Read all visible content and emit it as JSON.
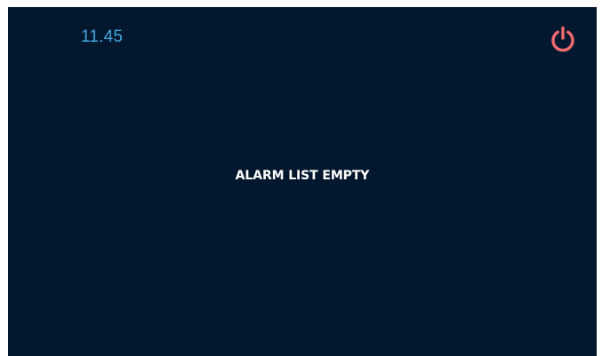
{
  "status_bar": {
    "time": "11.45",
    "power_icon": "power-icon"
  },
  "alarm_list": {
    "empty_message": "ALARM LIST EMPTY"
  },
  "colors": {
    "background": "#03182e",
    "time": "#3fa9e0",
    "power_icon": "#f06b6e",
    "message": "#ffffff"
  }
}
